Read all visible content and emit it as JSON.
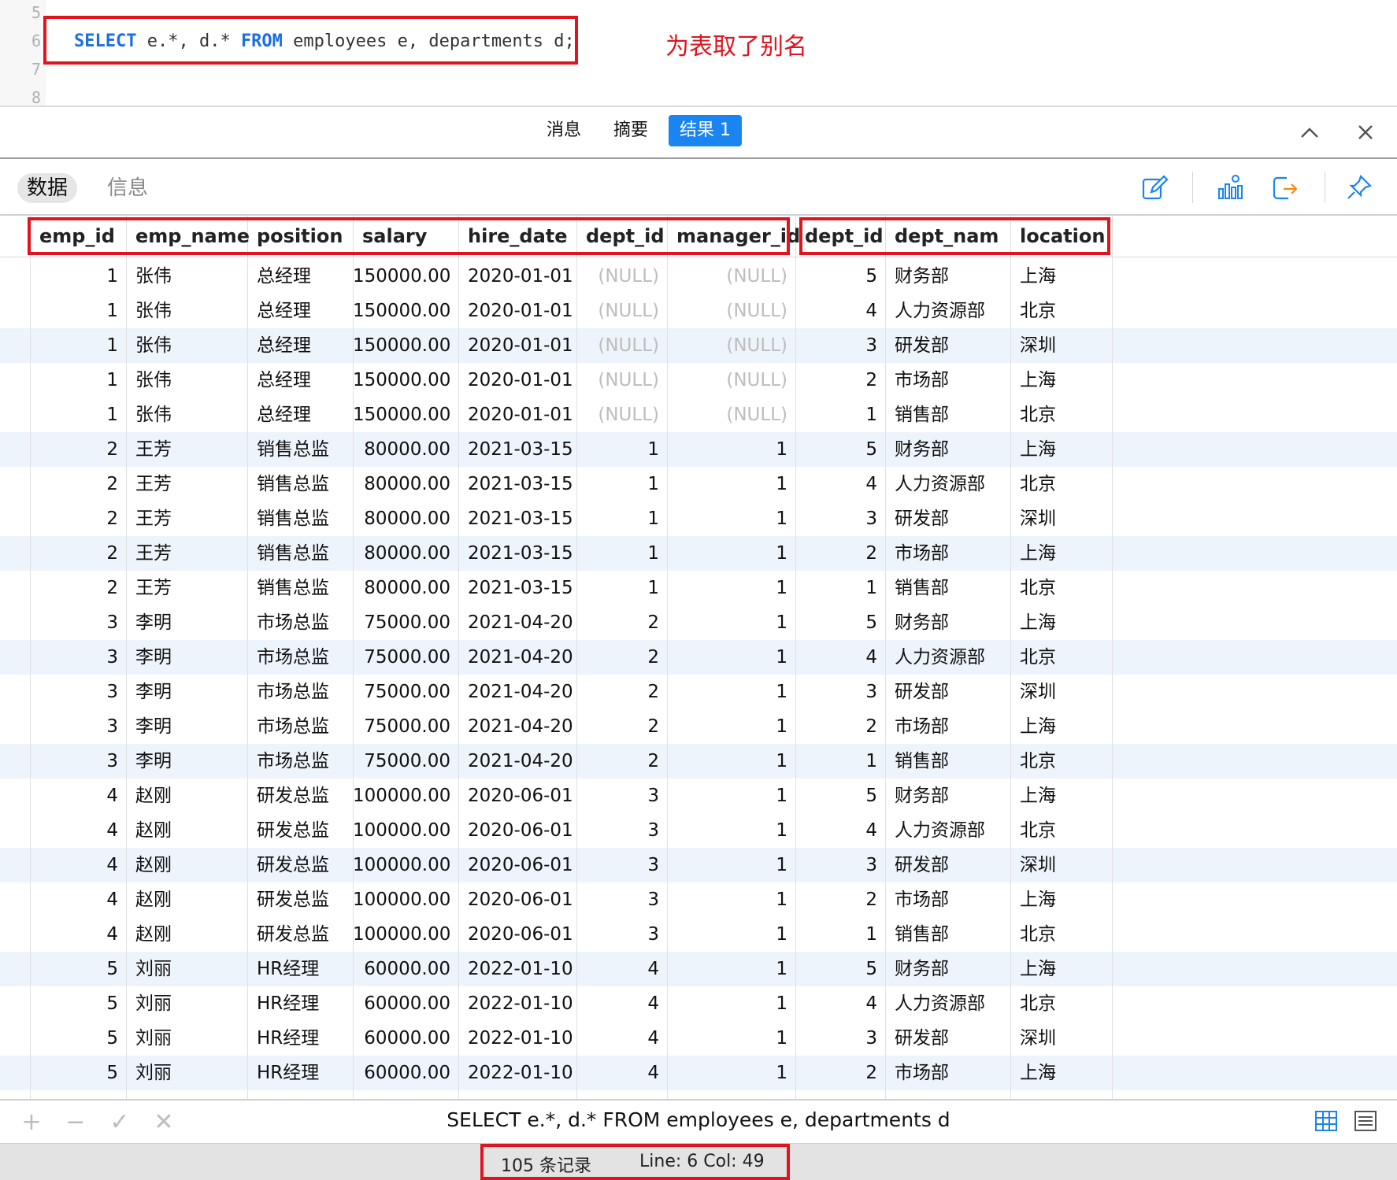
{
  "editor": {
    "line_numbers": [
      "5",
      "6",
      "7",
      "8"
    ],
    "code": {
      "kw_select": "SELECT",
      "part1": " e.*, d.* ",
      "kw_from": "FROM",
      "part2": " employees e, departments d;"
    },
    "annotation": "为表取了别名"
  },
  "result_tabs": {
    "messages": "消息",
    "summary": "摘要",
    "result": "结果 1"
  },
  "subbar": {
    "data_tab": "数据",
    "info_tab": "信息"
  },
  "columns": [
    "emp_id",
    "emp_name",
    "position",
    "salary",
    "hire_date",
    "dept_id",
    "manager_id",
    "dept_id",
    "dept_nam",
    "location"
  ],
  "rows": [
    [
      "1",
      "张伟",
      "总经理",
      "150000.00",
      "2020-01-01",
      "(NULL)",
      "(NULL)",
      "5",
      "财务部",
      "上海"
    ],
    [
      "1",
      "张伟",
      "总经理",
      "150000.00",
      "2020-01-01",
      "(NULL)",
      "(NULL)",
      "4",
      "人力资源部",
      "北京"
    ],
    [
      "1",
      "张伟",
      "总经理",
      "150000.00",
      "2020-01-01",
      "(NULL)",
      "(NULL)",
      "3",
      "研发部",
      "深圳"
    ],
    [
      "1",
      "张伟",
      "总经理",
      "150000.00",
      "2020-01-01",
      "(NULL)",
      "(NULL)",
      "2",
      "市场部",
      "上海"
    ],
    [
      "1",
      "张伟",
      "总经理",
      "150000.00",
      "2020-01-01",
      "(NULL)",
      "(NULL)",
      "1",
      "销售部",
      "北京"
    ],
    [
      "2",
      "王芳",
      "销售总监",
      "80000.00",
      "2021-03-15",
      "1",
      "1",
      "5",
      "财务部",
      "上海"
    ],
    [
      "2",
      "王芳",
      "销售总监",
      "80000.00",
      "2021-03-15",
      "1",
      "1",
      "4",
      "人力资源部",
      "北京"
    ],
    [
      "2",
      "王芳",
      "销售总监",
      "80000.00",
      "2021-03-15",
      "1",
      "1",
      "3",
      "研发部",
      "深圳"
    ],
    [
      "2",
      "王芳",
      "销售总监",
      "80000.00",
      "2021-03-15",
      "1",
      "1",
      "2",
      "市场部",
      "上海"
    ],
    [
      "2",
      "王芳",
      "销售总监",
      "80000.00",
      "2021-03-15",
      "1",
      "1",
      "1",
      "销售部",
      "北京"
    ],
    [
      "3",
      "李明",
      "市场总监",
      "75000.00",
      "2021-04-20",
      "2",
      "1",
      "5",
      "财务部",
      "上海"
    ],
    [
      "3",
      "李明",
      "市场总监",
      "75000.00",
      "2021-04-20",
      "2",
      "1",
      "4",
      "人力资源部",
      "北京"
    ],
    [
      "3",
      "李明",
      "市场总监",
      "75000.00",
      "2021-04-20",
      "2",
      "1",
      "3",
      "研发部",
      "深圳"
    ],
    [
      "3",
      "李明",
      "市场总监",
      "75000.00",
      "2021-04-20",
      "2",
      "1",
      "2",
      "市场部",
      "上海"
    ],
    [
      "3",
      "李明",
      "市场总监",
      "75000.00",
      "2021-04-20",
      "2",
      "1",
      "1",
      "销售部",
      "北京"
    ],
    [
      "4",
      "赵刚",
      "研发总监",
      "100000.00",
      "2020-06-01",
      "3",
      "1",
      "5",
      "财务部",
      "上海"
    ],
    [
      "4",
      "赵刚",
      "研发总监",
      "100000.00",
      "2020-06-01",
      "3",
      "1",
      "4",
      "人力资源部",
      "北京"
    ],
    [
      "4",
      "赵刚",
      "研发总监",
      "100000.00",
      "2020-06-01",
      "3",
      "1",
      "3",
      "研发部",
      "深圳"
    ],
    [
      "4",
      "赵刚",
      "研发总监",
      "100000.00",
      "2020-06-01",
      "3",
      "1",
      "2",
      "市场部",
      "上海"
    ],
    [
      "4",
      "赵刚",
      "研发总监",
      "100000.00",
      "2020-06-01",
      "3",
      "1",
      "1",
      "销售部",
      "北京"
    ],
    [
      "5",
      "刘丽",
      "HR经理",
      "60000.00",
      "2022-01-10",
      "4",
      "1",
      "5",
      "财务部",
      "上海"
    ],
    [
      "5",
      "刘丽",
      "HR经理",
      "60000.00",
      "2022-01-10",
      "4",
      "1",
      "4",
      "人力资源部",
      "北京"
    ],
    [
      "5",
      "刘丽",
      "HR经理",
      "60000.00",
      "2022-01-10",
      "4",
      "1",
      "3",
      "研发部",
      "深圳"
    ],
    [
      "5",
      "刘丽",
      "HR经理",
      "60000.00",
      "2022-01-10",
      "4",
      "1",
      "2",
      "市场部",
      "上海"
    ]
  ],
  "alt_rows": [
    2,
    5,
    8,
    11,
    14,
    17,
    20,
    23
  ],
  "footer": {
    "add": "+",
    "remove": "−",
    "apply": "✓",
    "discard": "✕",
    "sql": "SELECT e.*, d.* FROM employees e, departments d"
  },
  "status": {
    "records": "105 条记录",
    "position": "Line: 6  Col: 49"
  },
  "colors": {
    "accent": "#1a85f0",
    "highlight_box": "#e0141e",
    "keyword": "#1a6fe0",
    "alt_row": "#eef4fb"
  }
}
